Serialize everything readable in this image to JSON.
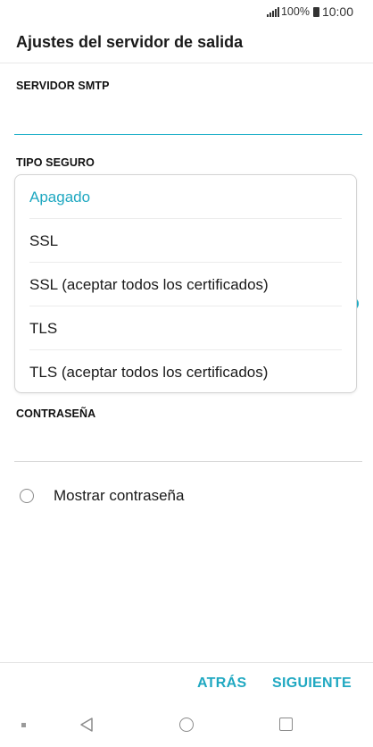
{
  "status_bar": {
    "battery_percent": "100%",
    "time": "10:00",
    "signal_icon": "signal-icon",
    "battery_icon": "battery-icon"
  },
  "header": {
    "title": "Ajustes del servidor de salida"
  },
  "form": {
    "smtp_label": "SERVIDOR SMTP",
    "smtp_value": "",
    "security_label": "TIPO SEGURO",
    "password_label": "CONTRASEÑA",
    "password_value": "",
    "show_password_label": "Mostrar contraseña"
  },
  "dropdown": {
    "selected": "Apagado",
    "options": [
      "Apagado",
      "SSL",
      "SSL (aceptar todos los certificados)",
      "TLS",
      "TLS (aceptar todos los certificados)"
    ],
    "accent_color": "#1fa8c1"
  },
  "actions": {
    "back_label": "ATRÁS",
    "next_label": "SIGUIENTE"
  },
  "nav_bar": {
    "icons": [
      "menu-dot-icon",
      "back-triangle-icon",
      "home-circle-icon",
      "recent-apps-icon"
    ]
  }
}
